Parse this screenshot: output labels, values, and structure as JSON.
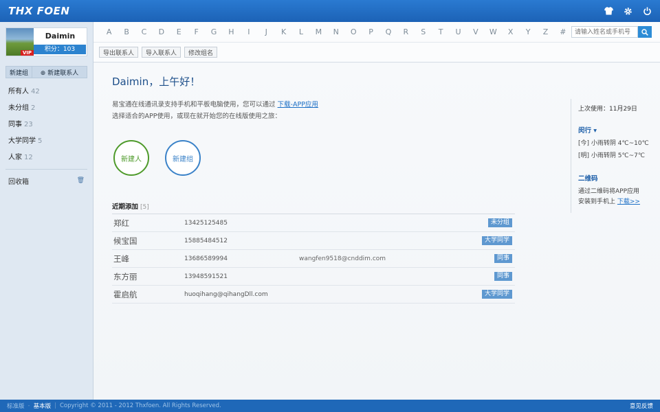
{
  "header": {
    "logo": "THX FOEN"
  },
  "profile": {
    "name": "Daimin",
    "vip": "VIP",
    "points": "积分：103"
  },
  "sidebar": {
    "new_group": "新建组",
    "new_contact": "⊕ 新建联系人",
    "groups": [
      {
        "label": "所有人",
        "count": "42"
      },
      {
        "label": "未分组",
        "count": "2"
      },
      {
        "label": "同事",
        "count": "23"
      },
      {
        "label": "大学同学",
        "count": "5"
      },
      {
        "label": "人家",
        "count": "12"
      }
    ],
    "trash": "回收箱"
  },
  "alphabet": [
    "A",
    "B",
    "C",
    "D",
    "E",
    "F",
    "G",
    "H",
    "I",
    "J",
    "K",
    "L",
    "M",
    "N",
    "O",
    "P",
    "Q",
    "R",
    "S",
    "T",
    "U",
    "V",
    "W",
    "X",
    "Y",
    "Z",
    "#"
  ],
  "search": {
    "placeholder": "请输入姓名或手机号"
  },
  "toolbar": {
    "export": "导出联系人",
    "import": "导入联系人",
    "rename": "修改组名"
  },
  "main": {
    "greeting": "Daimin，上午好！",
    "intro_line1": "易宝通在线通讯录支持手机和平板电脑使用，您可以通过",
    "intro_link": "下载-APP应用",
    "intro_line2": "选择适合的APP使用，或现在就开始您的在线版使用之旅：",
    "btn_new_contact": "新建人",
    "btn_new_group": "新建组",
    "recent_title": "近期添加",
    "recent_count": "[5]",
    "recent": [
      {
        "name": "郑红",
        "phone": "13425125485",
        "email": "",
        "tag": "未分组"
      },
      {
        "name": "候宝国",
        "phone": "15885484512",
        "email": "",
        "tag": "大学同学"
      },
      {
        "name": "王峰",
        "phone": "13686589994",
        "email": "wangfen9518@cnddim.com",
        "tag": "同事"
      },
      {
        "name": "东方丽",
        "phone": "13948591521",
        "email": "",
        "tag": "同事"
      },
      {
        "name": "霍启航",
        "phone": "huoqihang@qihangDll.com",
        "email": "",
        "tag": "大学同学"
      }
    ]
  },
  "rightpanel": {
    "last_used": "上次使用：11月29日",
    "city": "闵行 ▾",
    "weather_today": "[今] 小雨转阴  4℃~10℃",
    "weather_tomorrow": "[明] 小雨转阴  5℃~7℃",
    "qr_title": "二维码",
    "qr_text1": "通过二维码将APP应用",
    "qr_text2": "安装到手机上",
    "qr_link": "下载>>"
  },
  "footer": {
    "standard": "标准版",
    "basic": "基本版",
    "copyright": "Copyright © 2011 - 2012 Thxfoen. All Rights Reserved.",
    "feedback": "意见反馈"
  }
}
